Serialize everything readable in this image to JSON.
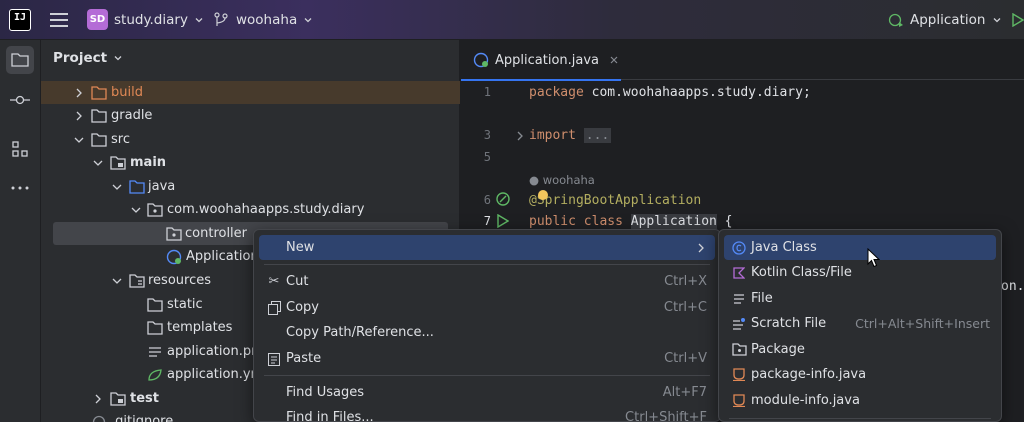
{
  "titlebar": {
    "logo_text": "IJ",
    "project_badge": "SD",
    "project_name": "study.diary",
    "branch_name": "woohaha",
    "run_config": "Application"
  },
  "project_panel": {
    "title": "Project",
    "tree": [
      {
        "label": "build",
        "type": "folder-excluded"
      },
      {
        "label": "gradle",
        "type": "folder"
      },
      {
        "label": "src",
        "type": "folder"
      },
      {
        "label": "main",
        "type": "module-folder"
      },
      {
        "label": "java",
        "type": "source-folder"
      },
      {
        "label": "com.woohahaapps.study.diary",
        "type": "package"
      },
      {
        "label": "controller",
        "type": "package"
      },
      {
        "label": "Application",
        "type": "spring-class"
      },
      {
        "label": "resources",
        "type": "resource-folder"
      },
      {
        "label": "static",
        "type": "folder"
      },
      {
        "label": "templates",
        "type": "folder"
      },
      {
        "label": "application.pro",
        "type": "properties-file"
      },
      {
        "label": "application.ym",
        "type": "yaml-file"
      },
      {
        "label": "test",
        "type": "module-folder"
      },
      {
        "label": ".gitignore",
        "type": "file"
      }
    ]
  },
  "editor": {
    "tab_label": "Application.java",
    "line_numbers": [
      "1",
      "3",
      "5",
      "6",
      "7"
    ],
    "code": {
      "line1_kw": "package",
      "line1_rest": " com.woohahaapps.study.diary;",
      "line3_kw": "import",
      "line3_fold": "...",
      "author_hint": "woohaha",
      "line6": "@SpringBootApplication",
      "line7_kw": "public class",
      "line7_cls": "Application",
      "line7_rest": " {",
      "line_partial": "on."
    }
  },
  "context_menu": {
    "items": [
      {
        "label": "New",
        "shortcut": "",
        "icon": "none",
        "highlighted": true,
        "has_submenu": true
      },
      {
        "label": "Cut",
        "shortcut": "Ctrl+X",
        "icon": "scissors-icon"
      },
      {
        "label": "Copy",
        "shortcut": "Ctrl+C",
        "icon": "copy-icon"
      },
      {
        "label": "Copy Path/Reference...",
        "shortcut": "",
        "icon": "none"
      },
      {
        "label": "Paste",
        "shortcut": "Ctrl+V",
        "icon": "paste-icon"
      },
      {
        "label": "Find Usages",
        "shortcut": "Alt+F7",
        "icon": "none"
      },
      {
        "label": "Find in Files...",
        "shortcut": "Ctrl+Shift+F",
        "icon": "none"
      }
    ]
  },
  "submenu": {
    "items": [
      {
        "label": "Java Class",
        "shortcut": "",
        "icon": "java-class-icon",
        "highlighted": true
      },
      {
        "label": "Kotlin Class/File",
        "shortcut": "",
        "icon": "kotlin-icon"
      },
      {
        "label": "File",
        "shortcut": "",
        "icon": "file-icon"
      },
      {
        "label": "Scratch File",
        "shortcut": "Ctrl+Alt+Shift+Insert",
        "icon": "scratch-file-icon"
      },
      {
        "label": "Package",
        "shortcut": "",
        "icon": "package-icon"
      },
      {
        "label": "package-info.java",
        "shortcut": "",
        "icon": "java-file-icon"
      },
      {
        "label": "module-info.java",
        "shortcut": "",
        "icon": "java-file-icon"
      }
    ]
  },
  "colors": {
    "accent": "#3574f0",
    "highlight": "#2e436e",
    "keyword": "#cf8e6d",
    "annotation": "#b3ae60"
  }
}
